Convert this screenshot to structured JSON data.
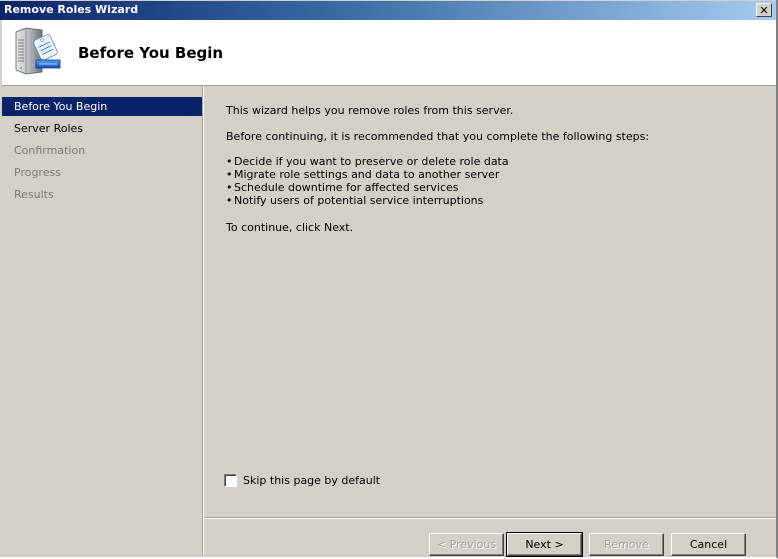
{
  "window": {
    "title": "Remove Roles Wizard",
    "close_label": "✕"
  },
  "header": {
    "icon": "server-roles-icon",
    "title": "Before You Begin"
  },
  "nav": {
    "items": [
      {
        "label": "Before You Begin",
        "state": "active"
      },
      {
        "label": "Server Roles",
        "state": "enabled"
      },
      {
        "label": "Confirmation",
        "state": "disabled"
      },
      {
        "label": "Progress",
        "state": "disabled"
      },
      {
        "label": "Results",
        "state": "disabled"
      }
    ]
  },
  "content": {
    "intro": "This wizard helps you remove roles from this server.",
    "recommend": "Before continuing, it is recommended that you complete the following steps:",
    "steps": [
      "Decide if you want to preserve or delete role data",
      "Migrate role settings and data to another server",
      "Schedule downtime for affected services",
      "Notify users of potential service interruptions"
    ],
    "continue_text": "To continue, click Next.",
    "skip_label": "Skip this page by default",
    "skip_checked": false
  },
  "buttons": {
    "previous": "< Previous",
    "next": "Next >",
    "remove": "Remove",
    "cancel": "Cancel"
  },
  "colors": {
    "titlebar_start": "#0a246a",
    "titlebar_end": "#a6caf0",
    "nav_active": "#0a246a",
    "face": "#d4d0c8"
  }
}
